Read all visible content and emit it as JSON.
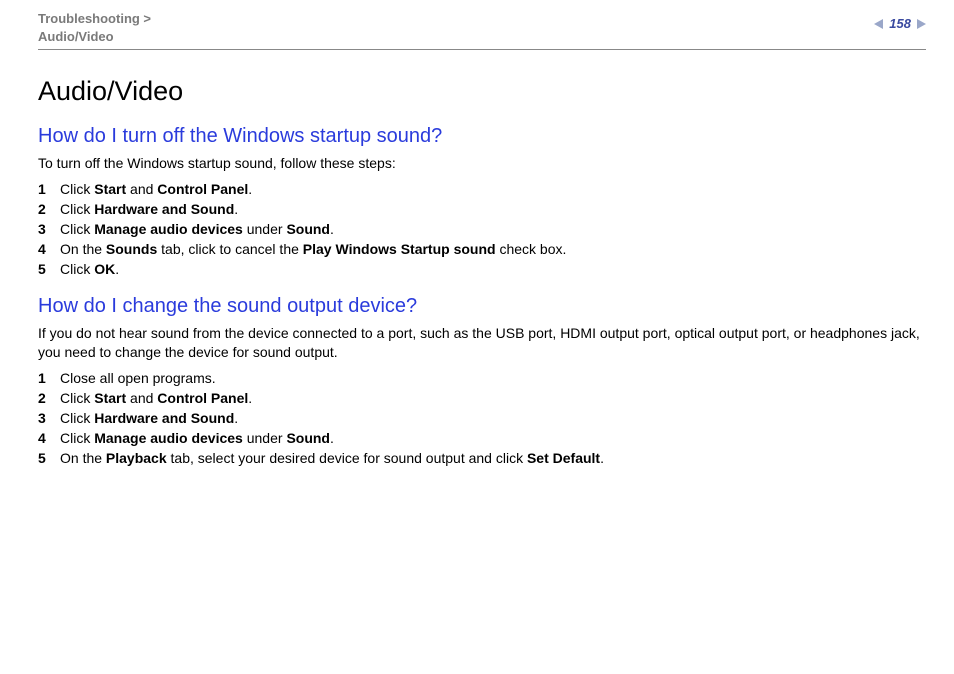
{
  "header": {
    "breadcrumb_line1": "Troubleshooting >",
    "breadcrumb_line2": "Audio/Video",
    "page_number": "158"
  },
  "title": "Audio/Video",
  "sections": [
    {
      "heading": "How do I turn off the Windows startup sound?",
      "intro": "To turn off the Windows startup sound, follow these steps:",
      "steps": [
        {
          "n": "1",
          "html": "Click <b>Start</b> and <b>Control Panel</b>."
        },
        {
          "n": "2",
          "html": "Click <b>Hardware and Sound</b>."
        },
        {
          "n": "3",
          "html": "Click <b>Manage audio devices</b> under <b>Sound</b>."
        },
        {
          "n": "4",
          "html": "On the <b>Sounds</b> tab, click to cancel the <b>Play Windows Startup sound</b> check box."
        },
        {
          "n": "5",
          "html": "Click <b>OK</b>."
        }
      ]
    },
    {
      "heading": "How do I change the sound output device?",
      "intro": "If you do not hear sound from the device connected to a port, such as the USB port, HDMI output port, optical output port, or headphones jack, you need to change the device for sound output.",
      "steps": [
        {
          "n": "1",
          "html": "Close all open programs."
        },
        {
          "n": "2",
          "html": "Click <b>Start</b> and <b>Control Panel</b>."
        },
        {
          "n": "3",
          "html": "Click <b>Hardware and Sound</b>."
        },
        {
          "n": "4",
          "html": "Click <b>Manage audio devices</b> under <b>Sound</b>."
        },
        {
          "n": "5",
          "html": "On the <b>Playback</b> tab, select your desired device for sound output and click <b>Set Default</b>."
        }
      ]
    }
  ]
}
